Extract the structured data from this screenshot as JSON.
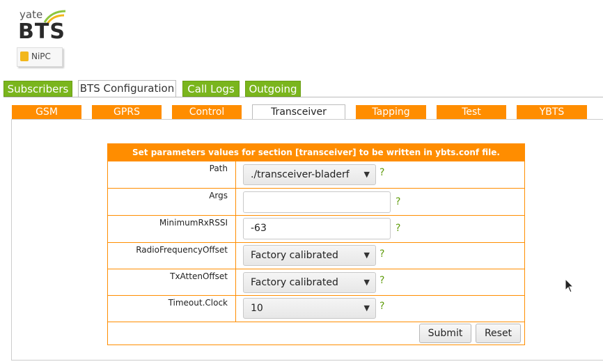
{
  "logo": {
    "line1": "yate",
    "line2": "BTS",
    "badge": "NiPC"
  },
  "top_tabs": [
    {
      "label": "Subscribers",
      "active": false
    },
    {
      "label": "BTS Configuration",
      "active": true
    },
    {
      "label": "Call Logs",
      "active": false
    },
    {
      "label": "Outgoing",
      "active": false
    }
  ],
  "sub_tabs": [
    {
      "label": "GSM",
      "active": false
    },
    {
      "label": "GPRS",
      "active": false
    },
    {
      "label": "Control",
      "active": false
    },
    {
      "label": "Transceiver",
      "active": true
    },
    {
      "label": "Tapping",
      "active": false
    },
    {
      "label": "Test",
      "active": false
    },
    {
      "label": "YBTS",
      "active": false
    }
  ],
  "form": {
    "header": "Set parameters values for section [transceiver] to be written in ybts.conf file.",
    "help": "?",
    "fields": [
      {
        "label": "Path",
        "type": "select",
        "value": "./transceiver-bladerf"
      },
      {
        "label": "Args",
        "type": "input",
        "value": ""
      },
      {
        "label": "MinimumRxRSSI",
        "type": "input",
        "value": "-63"
      },
      {
        "label": "RadioFrequencyOffset",
        "type": "select",
        "value": "Factory calibrated"
      },
      {
        "label": "TxAttenOffset",
        "type": "select",
        "value": "Factory calibrated"
      },
      {
        "label": "Timeout.Clock",
        "type": "select",
        "value": "10"
      }
    ],
    "submit_label": "Submit",
    "reset_label": "Reset"
  },
  "colors": {
    "orange": "#ff8d00",
    "green": "#7ab51d",
    "help": "#5e9b0a"
  },
  "icons": {
    "dropdown": "chevron-down-icon",
    "cursor": "mouse-pointer-icon"
  }
}
